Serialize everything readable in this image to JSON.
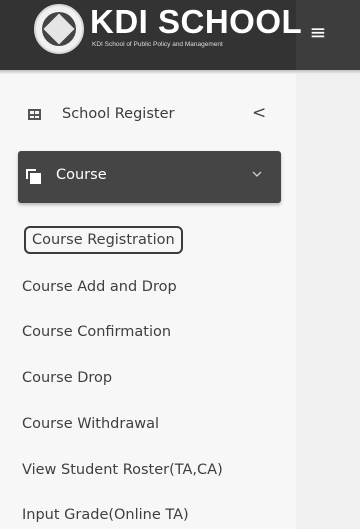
{
  "header": {
    "logo_title": "KDI SCHOOL",
    "logo_subtitle": "KDI School of Public Policy and Management",
    "menu_toggle_glyph": "≡"
  },
  "sidebar": {
    "school_register": {
      "label": "School Register",
      "chevron": "<"
    },
    "course": {
      "label": "Course",
      "expanded": true,
      "items": [
        {
          "label": "Course Registration",
          "highlighted": true
        },
        {
          "label": "Course Add and Drop"
        },
        {
          "label": "Course Confirmation"
        },
        {
          "label": "Course Drop"
        },
        {
          "label": "Course Withdrawal"
        },
        {
          "label": "View Student Roster(TA,CA)"
        },
        {
          "label": "Input Grade(Online TA)"
        }
      ]
    }
  },
  "icons": {
    "logo": "kdi-school-emblem-icon",
    "menu_toggle": "hamburger-menu-icon",
    "school_register": "table-grid-icon",
    "course": "copy-stack-icon",
    "course_chevron": "chevron-down-icon",
    "register_chevron": "chevron-left-icon"
  },
  "colors": {
    "header_bg": "#3d3d3d",
    "active_item_bg": "#454545",
    "sidebar_bg": "#f7f7f7",
    "text": "#3c3c3c"
  }
}
